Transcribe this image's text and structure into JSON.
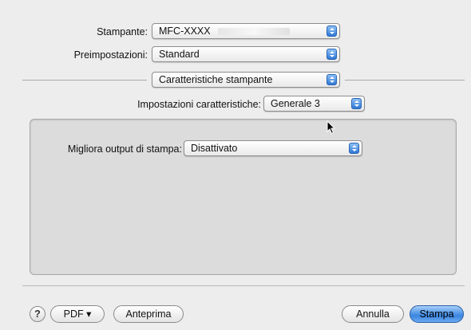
{
  "printer": {
    "label": "Stampante:",
    "value": "MFC-XXXX"
  },
  "presets": {
    "label": "Preimpostazioni:",
    "value": "Standard"
  },
  "section_popup": {
    "value": "Caratteristiche stampante"
  },
  "feature_sets": {
    "label": "Impostazioni caratteristiche:",
    "value": "Generale 3"
  },
  "improve_output": {
    "label": "Migliora output di stampa:",
    "value": "Disattivato"
  },
  "footer": {
    "help": "?",
    "pdf": "PDF ▾",
    "preview": "Anteprima",
    "cancel": "Annulla",
    "print": "Stampa"
  },
  "colors": {
    "accent": "#3b86e0",
    "panel": "#dcdcdc",
    "window": "#ededed"
  }
}
